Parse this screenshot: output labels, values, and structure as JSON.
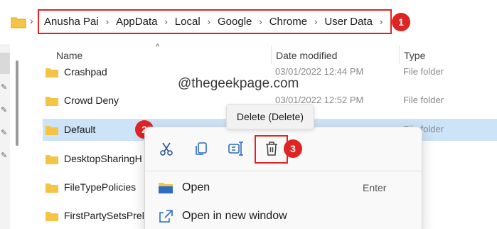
{
  "breadcrumb": {
    "items": [
      "Anusha Pai",
      "AppData",
      "Local",
      "Google",
      "Chrome",
      "User Data"
    ]
  },
  "annotations": {
    "b1": "1",
    "b2": "2",
    "b3": "3"
  },
  "columns": {
    "name": "Name",
    "date": "Date modified",
    "type": "Type"
  },
  "watermark": "@thegeekpage.com",
  "rows": [
    {
      "name": "Crashpad",
      "date": "03/01/2022 12:44 PM",
      "type": "File folder"
    },
    {
      "name": "Crowd Deny",
      "date": "03/01/2022 12:52 PM",
      "type": "File folder"
    },
    {
      "name": "Default",
      "date": "",
      "type": "File folder"
    },
    {
      "name": "DesktopSharingH",
      "date": "",
      "type": ""
    },
    {
      "name": "FileTypePolicies",
      "date": "",
      "type": ""
    },
    {
      "name": "FirstPartySetsPrel",
      "date": "",
      "type": ""
    }
  ],
  "tooltip": "Delete (Delete)",
  "context_menu": {
    "icons": [
      "cut-icon",
      "copy-icon",
      "rename-icon",
      "delete-icon"
    ],
    "items": [
      {
        "label": "Open",
        "shortcut": "Enter"
      },
      {
        "label": "Open in new window",
        "shortcut": ""
      }
    ]
  },
  "colors": {
    "annotation_red": "#e02424",
    "folder_yellow": "#f5c444",
    "selected_row": "#cce3f8"
  }
}
